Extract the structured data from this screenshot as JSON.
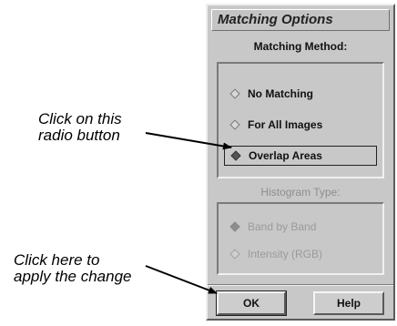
{
  "annotations": {
    "radio_callout": [
      "Click on this",
      "radio button"
    ],
    "apply_callout": [
      "Click here to",
      "apply the change"
    ]
  },
  "dialog": {
    "title": "Matching Options",
    "matching_method": {
      "label": "Matching Method:",
      "options": [
        {
          "label": "No Matching",
          "selected": false
        },
        {
          "label": "For All Images",
          "selected": false
        },
        {
          "label": "Overlap Areas",
          "selected": true
        }
      ]
    },
    "histogram_type": {
      "label": "Histogram Type:",
      "enabled": false,
      "options": [
        {
          "label": "Band by Band",
          "selected": true
        },
        {
          "label": "Intensity (RGB)",
          "selected": false
        }
      ]
    },
    "buttons": {
      "ok": "OK",
      "help": "Help"
    }
  }
}
